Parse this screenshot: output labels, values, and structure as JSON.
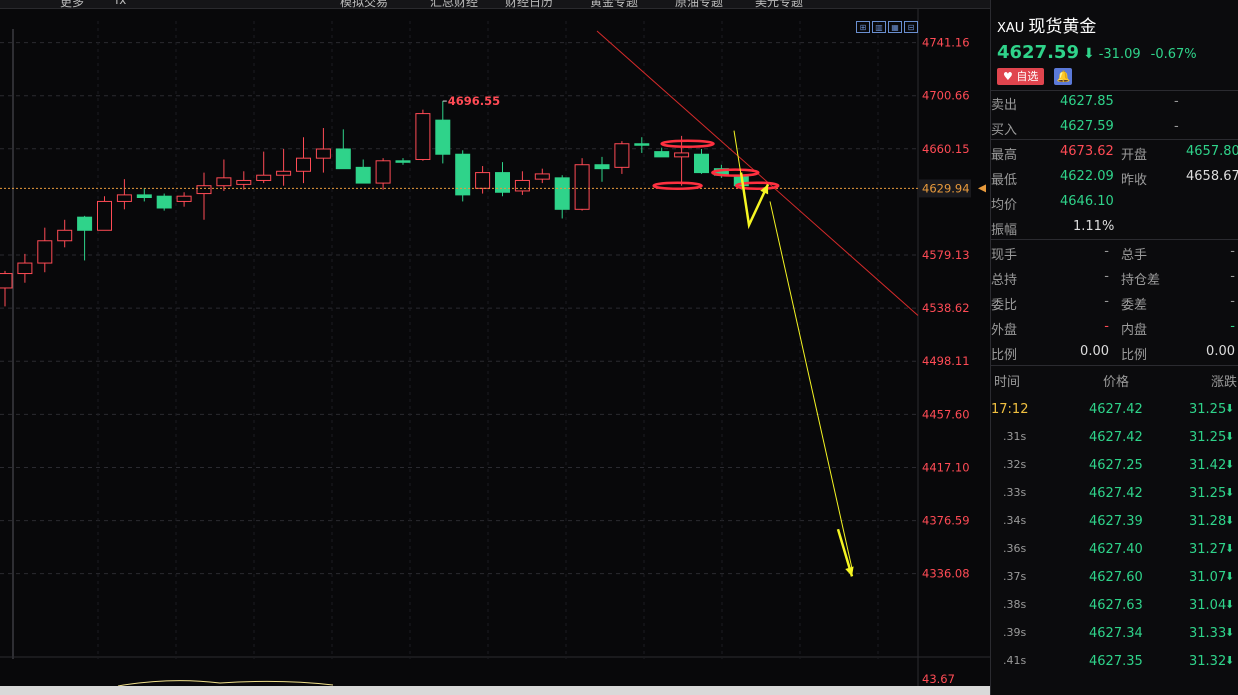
{
  "toolbar": {
    "items": [
      "更多",
      "fx",
      "模拟交易",
      "汇总财经",
      "财经日历",
      "黄金专题",
      "原油专题",
      "美元专题"
    ]
  },
  "colors": {
    "up": "#ff4b55",
    "down": "#2fd38a",
    "annotation_arrow": "#f5f523",
    "trend_line": "#d42a2a",
    "price_line": "#e89a3c"
  },
  "chart_data": {
    "type": "candlestick",
    "y_ticks": [
      "4741.16",
      "4700.66",
      "4660.15",
      "4579.13",
      "4538.62",
      "4498.11",
      "4457.60",
      "4417.10",
      "4376.59",
      "4336.08"
    ],
    "ylim": [
      4316,
      4750
    ],
    "high_label": "4696.55",
    "current_price_label": "4629.94",
    "volume_tick": "43.67",
    "candles": [
      {
        "o": 4554,
        "h": 4567,
        "l": 4540,
        "c": 4565
      },
      {
        "o": 4565,
        "h": 4580,
        "l": 4558,
        "c": 4573
      },
      {
        "o": 4573,
        "h": 4600,
        "l": 4566,
        "c": 4590
      },
      {
        "o": 4590,
        "h": 4606,
        "l": 4585,
        "c": 4598
      },
      {
        "o": 4608,
        "h": 4609,
        "l": 4575,
        "c": 4598
      },
      {
        "o": 4598,
        "h": 4624,
        "l": 4598,
        "c": 4620
      },
      {
        "o": 4620,
        "h": 4637,
        "l": 4614,
        "c": 4625
      },
      {
        "o": 4625,
        "h": 4630,
        "l": 4620,
        "c": 4623
      },
      {
        "o": 4624,
        "h": 4626,
        "l": 4613,
        "c": 4615
      },
      {
        "o": 4620,
        "h": 4627,
        "l": 4616,
        "c": 4624
      },
      {
        "o": 4626,
        "h": 4642,
        "l": 4606,
        "c": 4632
      },
      {
        "o": 4632,
        "h": 4652,
        "l": 4628,
        "c": 4638
      },
      {
        "o": 4633,
        "h": 4643,
        "l": 4629,
        "c": 4636
      },
      {
        "o": 4636,
        "h": 4658,
        "l": 4634,
        "c": 4640
      },
      {
        "o": 4640,
        "h": 4660,
        "l": 4632,
        "c": 4643
      },
      {
        "o": 4643,
        "h": 4669,
        "l": 4634,
        "c": 4653
      },
      {
        "o": 4653,
        "h": 4676,
        "l": 4642,
        "c": 4660
      },
      {
        "o": 4660,
        "h": 4675,
        "l": 4646,
        "c": 4645
      },
      {
        "o": 4646,
        "h": 4652,
        "l": 4636,
        "c": 4634
      },
      {
        "o": 4634,
        "h": 4653,
        "l": 4629,
        "c": 4651
      },
      {
        "o": 4651,
        "h": 4653,
        "l": 4648,
        "c": 4650
      },
      {
        "o": 4652,
        "h": 4690,
        "l": 4651,
        "c": 4687
      },
      {
        "o": 4682,
        "h": 4696.55,
        "l": 4649,
        "c": 4656
      },
      {
        "o": 4656,
        "h": 4659,
        "l": 4620,
        "c": 4625
      },
      {
        "o": 4630,
        "h": 4647,
        "l": 4626,
        "c": 4642
      },
      {
        "o": 4642,
        "h": 4650,
        "l": 4624,
        "c": 4627
      },
      {
        "o": 4628,
        "h": 4643,
        "l": 4625,
        "c": 4636
      },
      {
        "o": 4637,
        "h": 4645,
        "l": 4634,
        "c": 4641
      },
      {
        "o": 4638,
        "h": 4640,
        "l": 4607,
        "c": 4614
      },
      {
        "o": 4614,
        "h": 4653,
        "l": 4613,
        "c": 4648
      },
      {
        "o": 4648,
        "h": 4654,
        "l": 4635,
        "c": 4645
      },
      {
        "o": 4646,
        "h": 4666,
        "l": 4641,
        "c": 4664
      },
      {
        "o": 4664,
        "h": 4669,
        "l": 4657,
        "c": 4663
      },
      {
        "o": 4658,
        "h": 4661,
        "l": 4654,
        "c": 4654
      },
      {
        "o": 4654,
        "h": 4670,
        "l": 4632,
        "c": 4657
      },
      {
        "o": 4656,
        "h": 4660,
        "l": 4641,
        "c": 4642
      },
      {
        "o": 4645,
        "h": 4648,
        "l": 4638,
        "c": 4640
      },
      {
        "o": 4640,
        "h": 4642,
        "l": 4629,
        "c": 4632
      }
    ]
  },
  "panel": {
    "symbol_code": "XAU",
    "symbol_name": "现货黄金",
    "last": "4627.59",
    "arrow": "⬇",
    "change": "-31.09",
    "change_pct": "-0.67%",
    "fav_label": "♥ 自选",
    "bell": "🔔",
    "sell_label": "卖出",
    "sell": "4627.85",
    "sell_vol": "-",
    "buy_label": "买入",
    "buy": "4627.59",
    "buy_vol": "-",
    "high_label": "最高",
    "high": "4673.62",
    "open_label": "开盘",
    "open": "4657.80",
    "low_label": "最低",
    "low": "4622.09",
    "prev_label": "昨收",
    "prev": "4658.67",
    "avg_label": "均价",
    "avg": "4646.10",
    "amp_label": "振幅",
    "amp": "1.11%",
    "stats": [
      {
        "l1": "现手",
        "v1": "-",
        "l2": "总手",
        "v2": "-"
      },
      {
        "l1": "总持",
        "v1": "-",
        "l2": "持仓差",
        "v2": "-"
      },
      {
        "l1": "委比",
        "v1": "-",
        "l2": "委差",
        "v2": "-"
      },
      {
        "l1": "外盘",
        "v1": "-",
        "l2": "内盘",
        "v2": "-"
      },
      {
        "l1": "比例",
        "v1": "0.00",
        "l2": "比例",
        "v2": "0.00"
      }
    ],
    "tick_headers": [
      "时间",
      "价格",
      "涨跌"
    ],
    "ticks": [
      {
        "t": "17:12",
        "p": "4627.42",
        "c": "31.25"
      },
      {
        "t": ".31s",
        "p": "4627.42",
        "c": "31.25"
      },
      {
        "t": ".32s",
        "p": "4627.25",
        "c": "31.42"
      },
      {
        "t": ".33s",
        "p": "4627.42",
        "c": "31.25"
      },
      {
        "t": ".34s",
        "p": "4627.39",
        "c": "31.28"
      },
      {
        "t": ".36s",
        "p": "4627.40",
        "c": "31.27"
      },
      {
        "t": ".37s",
        "p": "4627.60",
        "c": "31.07"
      },
      {
        "t": ".38s",
        "p": "4627.63",
        "c": "31.04"
      },
      {
        "t": ".39s",
        "p": "4627.34",
        "c": "31.33"
      },
      {
        "t": ".41s",
        "p": "4627.35",
        "c": "31.32"
      }
    ]
  }
}
